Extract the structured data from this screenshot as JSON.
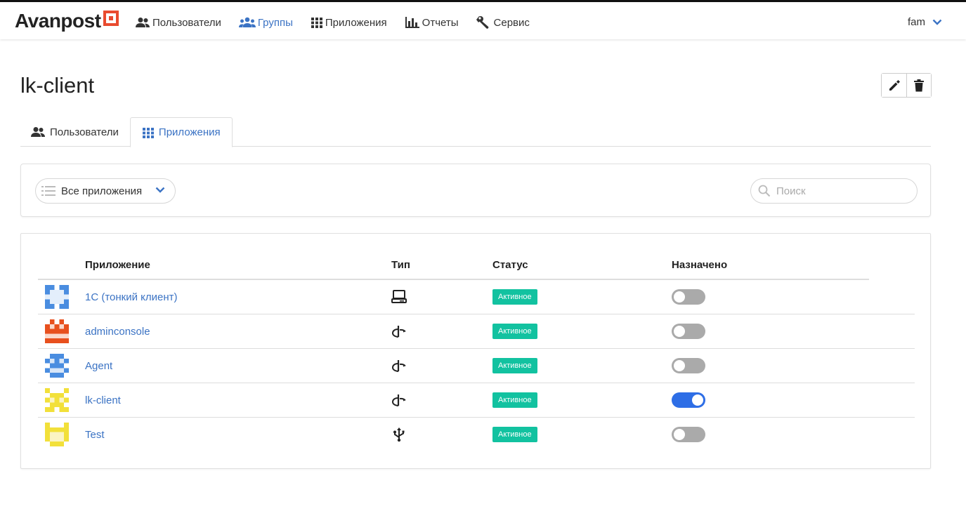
{
  "brand": {
    "name": "Avanpost",
    "accent": "#e94b2f"
  },
  "nav": {
    "users": "Пользователи",
    "groups": "Группы",
    "apps": "Приложения",
    "reports": "Отчеты",
    "service": "Сервис"
  },
  "user": {
    "name": "fam"
  },
  "page": {
    "title": "lk-client"
  },
  "tabs": {
    "users": "Пользователи",
    "apps": "Приложения"
  },
  "filter": {
    "selected": "Все приложения",
    "search_placeholder": "Поиск"
  },
  "table": {
    "headers": {
      "app": "Приложение",
      "type": "Тип",
      "status": "Статус",
      "assigned": "Назначено"
    },
    "rows": [
      {
        "name": "1С (тонкий клиент)",
        "type_icon": "desktop-icon",
        "status": "Активное",
        "assigned": false,
        "avatar_color": "#4a8de0"
      },
      {
        "name": "adminconsole",
        "type_icon": "openid-icon",
        "status": "Активное",
        "assigned": false,
        "avatar_color": "#e8501e"
      },
      {
        "name": "Agent",
        "type_icon": "openid-icon",
        "status": "Активное",
        "assigned": false,
        "avatar_color": "#4a8de0"
      },
      {
        "name": "lk-client",
        "type_icon": "openid-icon",
        "status": "Активное",
        "assigned": true,
        "avatar_color": "#f2e03a"
      },
      {
        "name": "Test",
        "type_icon": "usb-icon",
        "status": "Активное",
        "assigned": false,
        "avatar_color": "#f2e03a"
      }
    ]
  },
  "colors": {
    "link": "#3b73c4",
    "status_active": "#12c2a0",
    "toggle_on": "#2e6ee6"
  }
}
